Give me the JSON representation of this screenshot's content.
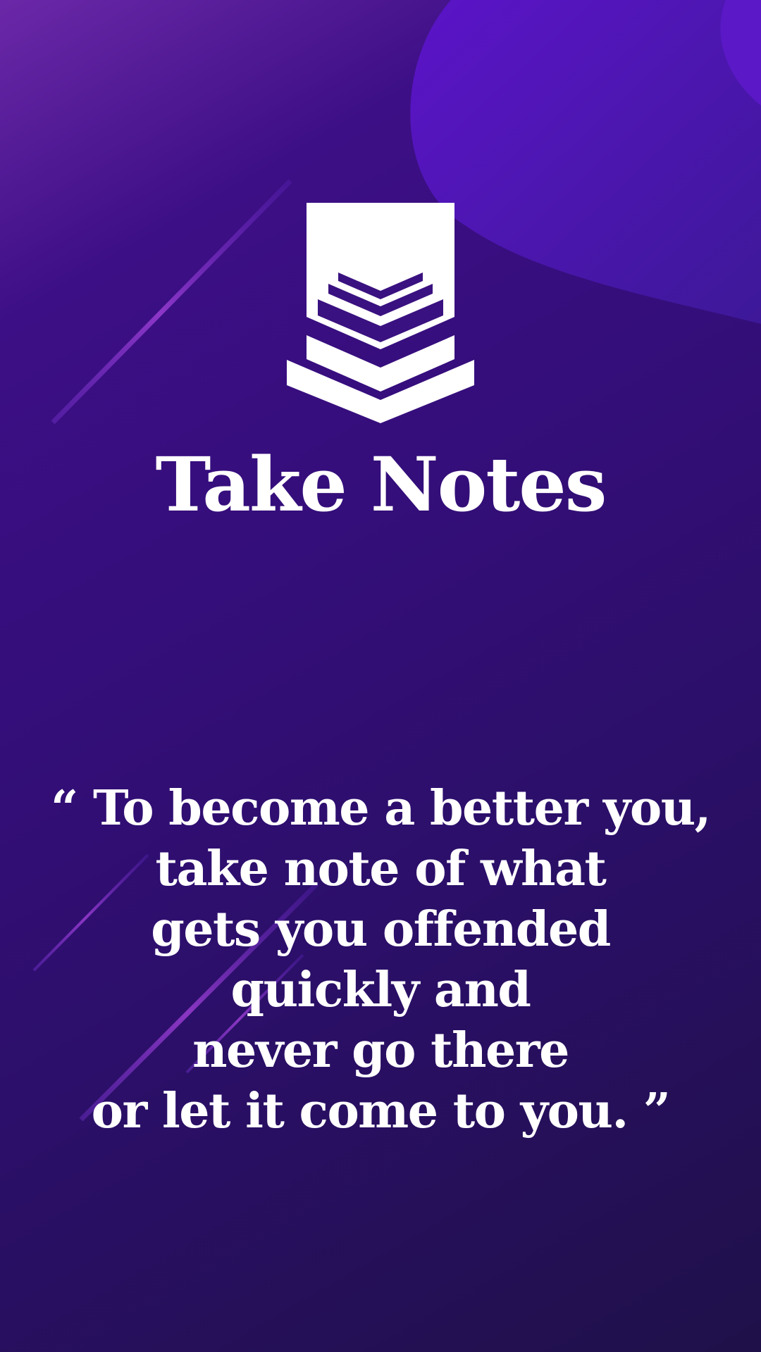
{
  "screen": {
    "title": "Take Notes",
    "quote_lines": [
      "“ To become a better you,",
      "take note of what",
      "gets you offended",
      "quickly and",
      "never go there",
      "or let it come to you. ”"
    ]
  },
  "icons": {
    "logo": "stacked-chevrons-badge-icon"
  },
  "colors": {
    "background_top": "#3d0f86",
    "background_bottom": "#1f1049",
    "accent_blob": "#5a16c2",
    "text": "#ffffff"
  }
}
